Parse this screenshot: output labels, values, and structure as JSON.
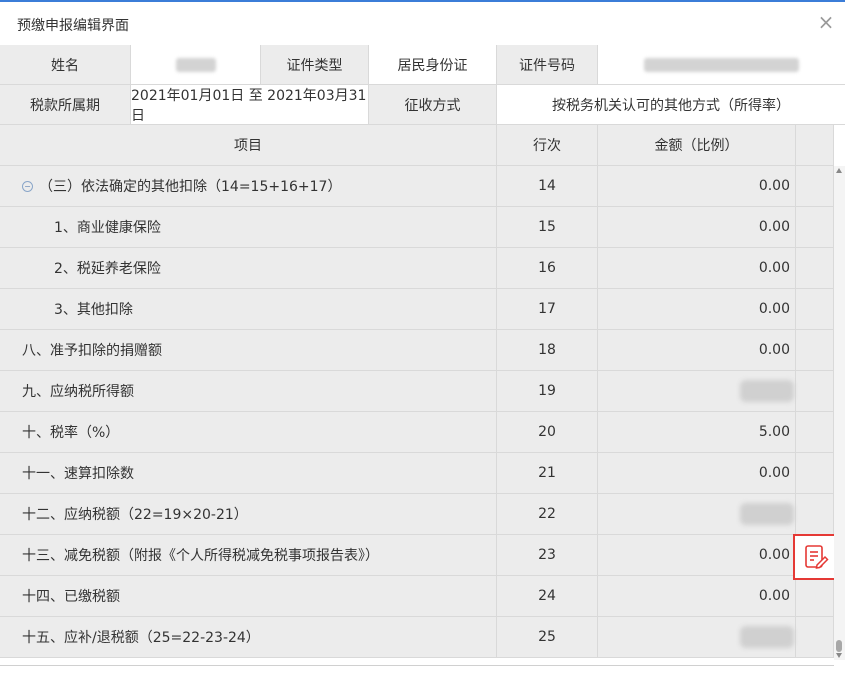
{
  "dialog": {
    "title": "预缴申报编辑界面",
    "close_symbol": "×"
  },
  "info": {
    "name_label": "姓名",
    "id_type_label": "证件类型",
    "id_type_value": "居民身份证",
    "id_no_label": "证件号码",
    "period_label": "税款所属期",
    "period_value": "2021年01月01日 至 2021年03月31日",
    "method_label": "征收方式",
    "method_value": "按税务机关认可的其他方式（所得率）"
  },
  "table": {
    "headers": {
      "item": "项目",
      "line": "行次",
      "amount": "金额（比例）"
    },
    "rows": [
      {
        "item": "（三）依法确定的其他扣除（14=15+16+17）",
        "line": "14",
        "amount": "0.00"
      },
      {
        "item": "1、商业健康保险",
        "line": "15",
        "amount": "0.00"
      },
      {
        "item": "2、税延养老保险",
        "line": "16",
        "amount": "0.00"
      },
      {
        "item": "3、其他扣除",
        "line": "17",
        "amount": "0.00"
      },
      {
        "item": "八、准予扣除的捐赠额",
        "line": "18",
        "amount": "0.00"
      },
      {
        "item": "九、应纳税所得额",
        "line": "19",
        "amount": ""
      },
      {
        "item": "十、税率（%）",
        "line": "20",
        "amount": "5.00"
      },
      {
        "item": "十一、速算扣除数",
        "line": "21",
        "amount": "0.00"
      },
      {
        "item": "十二、应纳税额（22=19×20-21）",
        "line": "22",
        "amount": ""
      },
      {
        "item": "十三、减免税额（附报《个人所得税减免税事项报告表》）",
        "line": "23",
        "amount": "0.00"
      },
      {
        "item": "十四、已缴税额",
        "line": "24",
        "amount": "0.00"
      },
      {
        "item": "十五、应补/退税额（25=22-23-24）",
        "line": "25",
        "amount": ""
      }
    ]
  },
  "icons": {
    "collapse": "collapse-minus-icon",
    "edit": "edit-document-icon"
  },
  "colors": {
    "highlight_border": "#e53935",
    "edit_icon": "#e53935",
    "accent_line": "#3b7dd8"
  }
}
